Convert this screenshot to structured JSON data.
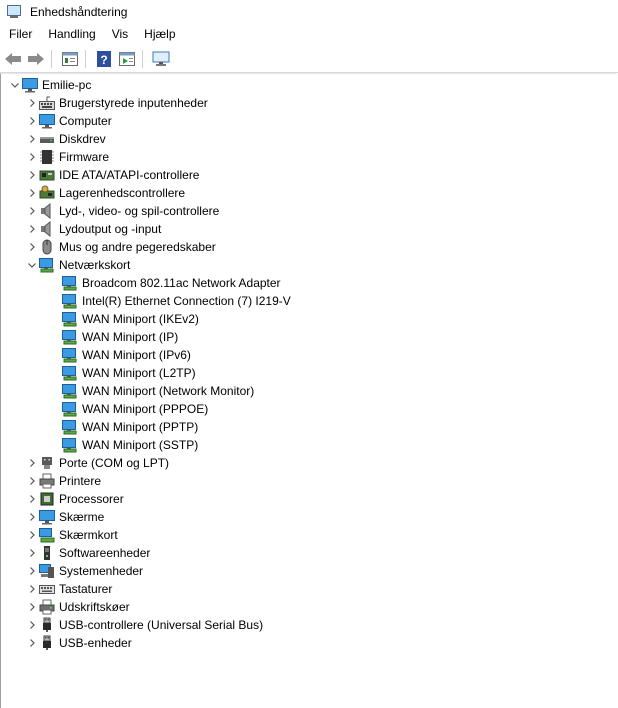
{
  "window": {
    "title": "Enhedshåndtering"
  },
  "menu": [
    "Filer",
    "Handling",
    "Vis",
    "Hjælp"
  ],
  "toolbar": [
    "back-icon",
    "forward-icon",
    "properties-icon",
    "help-icon",
    "details-icon",
    "monitor-icon"
  ],
  "root": {
    "label": "Emilie-pc",
    "icon": "computer-icon",
    "expanded": true
  },
  "categories": [
    {
      "label": "Brugerstyrede inputenheder",
      "icon": "hid-icon"
    },
    {
      "label": "Computer",
      "icon": "computer-icon"
    },
    {
      "label": "Diskdrev",
      "icon": "disk-drive-icon"
    },
    {
      "label": "Firmware",
      "icon": "firmware-icon"
    },
    {
      "label": "IDE ATA/ATAPI-controllere",
      "icon": "ide-icon"
    },
    {
      "label": "Lagerenhedscontrollere",
      "icon": "storage-controller-icon"
    },
    {
      "label": "Lyd-, video- og spil-controllere",
      "icon": "audio-icon"
    },
    {
      "label": "Lydoutput og -input",
      "icon": "audio-icon"
    },
    {
      "label": "Mus og andre pegeredskaber",
      "icon": "mouse-icon"
    },
    {
      "label": "Netværkskort",
      "icon": "network-adapter-icon",
      "expanded": true,
      "children": [
        "Broadcom 802.11ac Network Adapter",
        "Intel(R) Ethernet Connection (7) I219-V",
        "WAN Miniport (IKEv2)",
        "WAN Miniport (IP)",
        "WAN Miniport (IPv6)",
        "WAN Miniport (L2TP)",
        "WAN Miniport (Network Monitor)",
        "WAN Miniport (PPPOE)",
        "WAN Miniport (PPTP)",
        "WAN Miniport (SSTP)"
      ]
    },
    {
      "label": "Porte (COM og LPT)",
      "icon": "port-icon"
    },
    {
      "label": "Printere",
      "icon": "printer-icon"
    },
    {
      "label": "Processorer",
      "icon": "processor-icon"
    },
    {
      "label": "Skærme",
      "icon": "monitor-icon"
    },
    {
      "label": "Skærmkort",
      "icon": "display-adapter-icon"
    },
    {
      "label": "Softwareenheder",
      "icon": "software-device-icon"
    },
    {
      "label": "Systemenheder",
      "icon": "system-device-icon"
    },
    {
      "label": "Tastaturer",
      "icon": "keyboard-icon"
    },
    {
      "label": "Udskriftskøer",
      "icon": "print-queue-icon"
    },
    {
      "label": "USB-controllere (Universal Serial Bus)",
      "icon": "usb-icon"
    },
    {
      "label": "USB-enheder",
      "icon": "usb-icon"
    }
  ],
  "colors": {
    "accent": "#1e7cd6",
    "monitor_fill": "#3a9be3",
    "text": "#000000"
  }
}
